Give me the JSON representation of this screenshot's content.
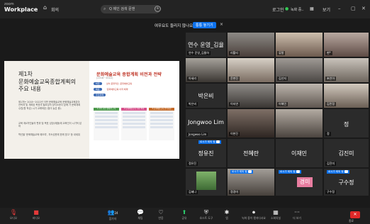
{
  "app": {
    "brand_top": "zoom",
    "brand": "Workplace"
  },
  "topbar": {
    "home": "⌂",
    "meeting": "회의",
    "search_placeholder": "Q 제인 검색 문앤",
    "login": "로그인",
    "shield": "녹화 중..",
    "view": "보기",
    "minimize": "–",
    "maximize": "▢",
    "close": "✕"
  },
  "notice": {
    "question": "여우요도 들리지 않나요?",
    "button": "통통 놓기기",
    "close": "×"
  },
  "slide": {
    "title_lines": [
      "제1차",
      "문화예술교육종합계획의",
      "주요 내용"
    ],
    "para1": "제1차는 2018~2022년 이번 문화예술교육 문화예술교육분야 전략과 및 개획된 목표의 필요성의 장지소한다 앞에 가 문화계획 수립(원 적성) 시가 교래와된 (점이 늦은 중).",
    "para2": "교육 제4차인들의 편위 및 목표 성장(제출)에 교육인이 시기적 답하",
    "para3": "학년을 '문화예술교육 때도여', 지속성문제 한께 방고' 등 내세워",
    "right_heading": "문화예술교육 종합계획 비전과 전략",
    "right_sub": "(2018~2022)",
    "tags": [
      "비전",
      "목표",
      "추진과제"
    ],
    "tag_lines": [
      "삶이 문화적인, 문화예술교육",
      "'문화예술교육 이력 체제'"
    ],
    "columns": [
      "1.자역 기반 생태계 구축",
      "2.문화예술교육 기회 확대",
      "3.문화예술교육 인력육성"
    ]
  },
  "tiles": [
    {
      "name": "연수 운영_김율",
      "label": "연수 운영_김율하"
    },
    {
      "name": "",
      "label": "리틀티"
    },
    {
      "name": "",
      "label": "류탈"
    },
    {
      "name": "",
      "label": "현*"
    },
    {
      "name": "",
      "label": "아세리"
    },
    {
      "name": "",
      "label": "윤현진"
    },
    {
      "name": "",
      "label": "김선지"
    },
    {
      "name": "",
      "label": "초인아"
    },
    {
      "name": "박은비",
      "label": "박은비"
    },
    {
      "name": "",
      "label": "이지연"
    },
    {
      "name": "",
      "label": "이해민"
    },
    {
      "name": "",
      "label": "김민정"
    },
    {
      "name": "Jongwoo Lim",
      "label": "Jongwoo Lim"
    },
    {
      "name": "",
      "label": "이현진"
    },
    {
      "name": "",
      "label": ""
    },
    {
      "name": "정",
      "label": "정"
    },
    {
      "name": "정유진",
      "label": "정유진",
      "badge": "로시가 제외 됨"
    },
    {
      "name": "전혜란",
      "label": "전혜란"
    },
    {
      "name": "이재민",
      "label": "이재민"
    },
    {
      "name": "김진미",
      "label": "김진미"
    },
    {
      "name": "",
      "label": "김혜나"
    },
    {
      "name": "",
      "label": "정경미",
      "badge": "로시가 제외 됨"
    },
    {
      "name": "경미",
      "label": "",
      "badge": "로시가 제외 됨"
    },
    {
      "name": "구수정",
      "label": "구수정",
      "badge": "로시가 제외 됨"
    }
  ],
  "bottombar": {
    "mute": "오디오",
    "video": "비디오",
    "participants": "참가자",
    "participant_count": "24",
    "chat": "채팅",
    "react": "반응",
    "share": "공유",
    "host_tools": "호스트 도구",
    "apps": "앱",
    "record": "녹화",
    "record_sub": "녹화 중이 됐지다서요",
    "breakout": "소회의실",
    "more": "더 보기",
    "end": "종료"
  },
  "colors": {
    "accent": "#0e72ed",
    "speaker": "#f2d300",
    "end": "#e02828"
  }
}
